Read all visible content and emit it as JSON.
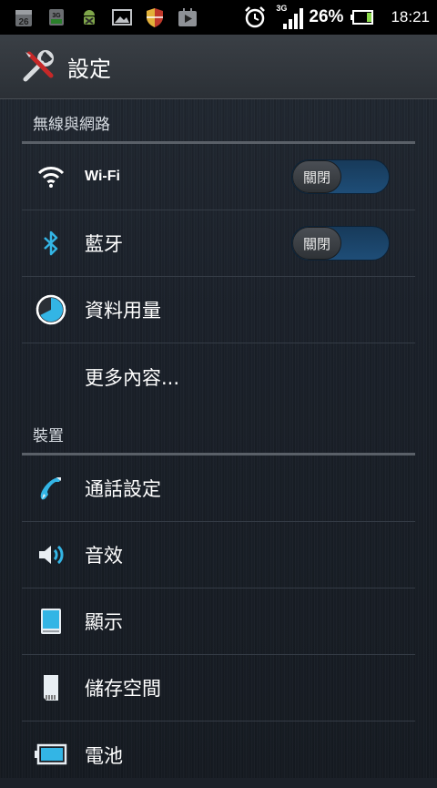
{
  "status_bar": {
    "left_icons": [
      "calendar-icon",
      "sim-3g-icon",
      "android-debug-icon",
      "image-icon",
      "shield-icon",
      "play-store-icon"
    ],
    "calendar_day": "26",
    "network": "3G",
    "battery_percent": "26%",
    "battery_level": 0.26,
    "time": "18:21"
  },
  "action_bar": {
    "title": "設定"
  },
  "sections": [
    {
      "header": "無線與網路",
      "items": [
        {
          "label": "Wi-Fi",
          "icon": "wifi-icon",
          "toggle": "關閉"
        },
        {
          "label": "藍牙",
          "icon": "bluetooth-icon",
          "toggle": "關閉"
        },
        {
          "label": "資料用量",
          "icon": "data-usage-icon"
        },
        {
          "label": "更多內容..."
        }
      ]
    },
    {
      "header": "裝置",
      "items": [
        {
          "label": "通話設定",
          "icon": "phone-icon"
        },
        {
          "label": "音效",
          "icon": "speaker-icon"
        },
        {
          "label": "顯示",
          "icon": "display-icon"
        },
        {
          "label": "儲存空間",
          "icon": "storage-icon"
        },
        {
          "label": "電池",
          "icon": "battery-icon"
        }
      ]
    }
  ],
  "colors": {
    "accent": "#33b5e5",
    "toggle_track": "#1e4d77",
    "background": "#1c2129"
  }
}
